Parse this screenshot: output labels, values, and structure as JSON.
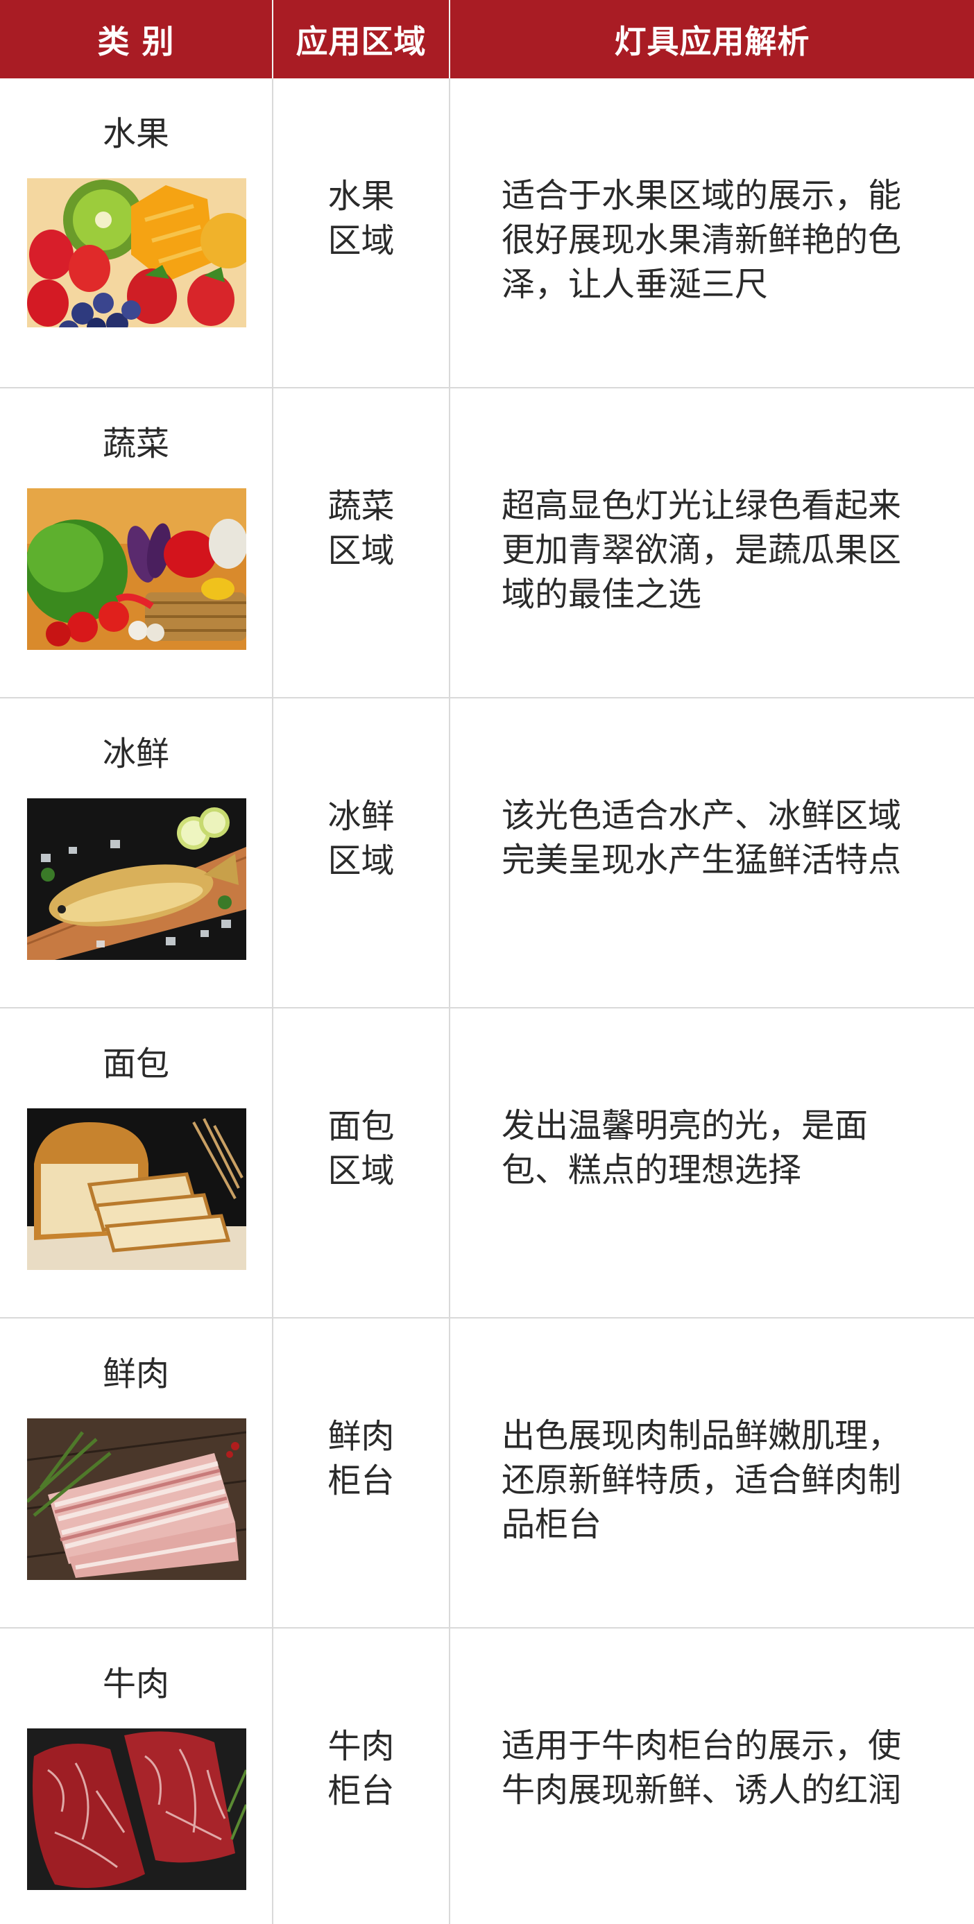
{
  "header": {
    "col1": "类 别",
    "col2": "应用区域",
    "col3": "灯具应用解析"
  },
  "rows": [
    {
      "category": "水果",
      "area_line1": "水果",
      "area_line2": "区域",
      "description": "适合于水果区域的展示，能很好展现水果清新鲜艳的色泽，让人垂涎三尺",
      "image": "fruits-photo"
    },
    {
      "category": "蔬菜",
      "area_line1": "蔬菜",
      "area_line2": "区域",
      "description": "超高显色灯光让绿色看起来更加青翠欲滴，是蔬瓜果区域的最佳之选",
      "image": "vegetables-photo"
    },
    {
      "category": "冰鲜",
      "area_line1": "冰鲜",
      "area_line2": "区域",
      "description": "该光色适合水产、冰鲜区域完美呈现水产生猛鲜活特点",
      "image": "fish-photo"
    },
    {
      "category": "面包",
      "area_line1": "面包",
      "area_line2": "区域",
      "description": "发出温馨明亮的光，是面包、糕点的理想选择",
      "image": "bread-photo"
    },
    {
      "category": "鲜肉",
      "area_line1": "鲜肉",
      "area_line2": "柜台",
      "description": "出色展现肉制品鲜嫩肌理，还原新鲜特质，适合鲜肉制品柜台",
      "image": "pork-photo"
    },
    {
      "category": "牛肉",
      "area_line1": "牛肉",
      "area_line2": "柜台",
      "description": "适用于牛肉柜台的展示，使牛肉展现新鲜、诱人的红润",
      "image": "beef-photo"
    }
  ],
  "colors": {
    "header_bg": "#a91c24",
    "header_text": "#ffffff",
    "grid_line": "#d9d9d9"
  }
}
